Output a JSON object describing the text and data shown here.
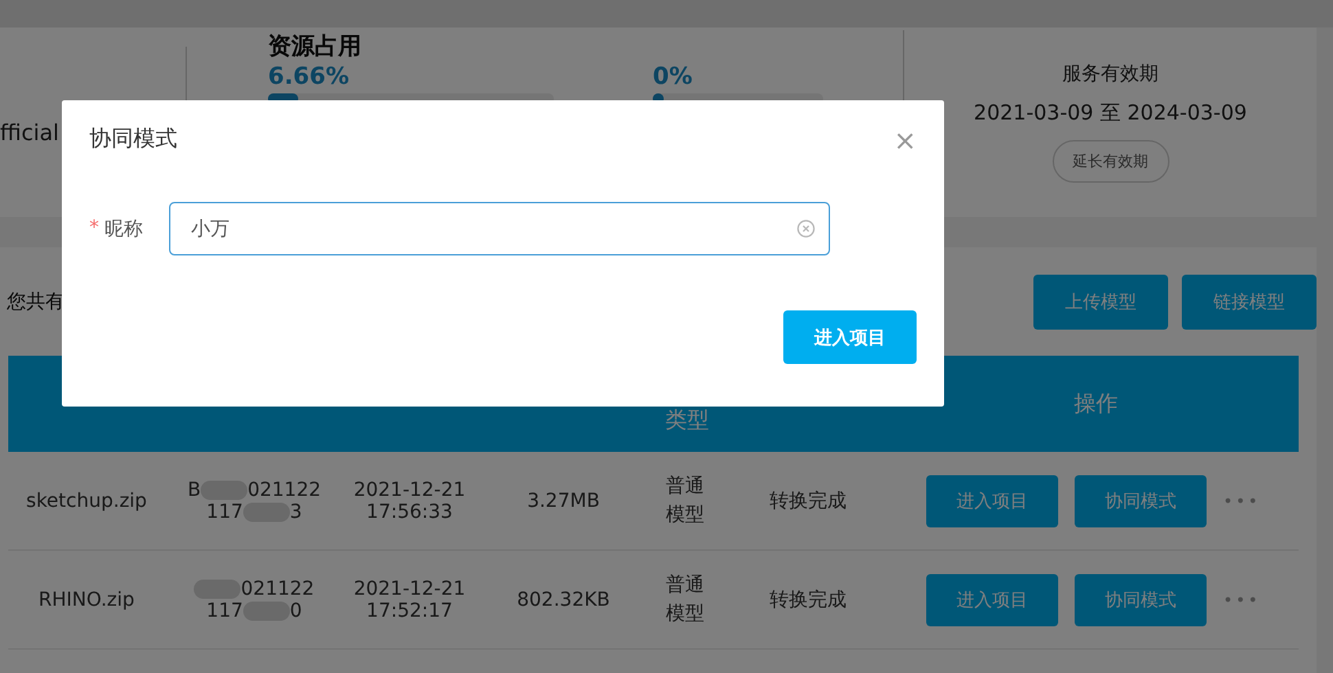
{
  "account": {
    "fragment": "fficial"
  },
  "resources": {
    "title": "资源占用",
    "meters": [
      {
        "reading": "6.66%",
        "level": 0.0666
      },
      {
        "reading": "0%",
        "level": 0
      }
    ]
  },
  "service": {
    "title": "服务有效期",
    "period": "2021-03-09 至 2024-03-09",
    "button": "延长有效期"
  },
  "summary": "您共有",
  "toolbar_buttons": [
    "上传模型",
    "链接模型"
  ],
  "table": {
    "type_header": "类型",
    "actions_header": "操作",
    "rows": [
      {
        "name": "sketchup.zip",
        "id_lines": [
          {
            "before": "B",
            "after": "021122"
          },
          {
            "before": "117",
            "after": "3"
          }
        ],
        "date": "2021-12-21",
        "time": "17:56:33",
        "size": "3.27MB",
        "type": "普通模型",
        "status": "转换完成",
        "actions": [
          "进入项目",
          "协同模式"
        ],
        "more": "•••"
      },
      {
        "name": "RHINO.zip",
        "id_lines": [
          {
            "after": "021122"
          },
          {
            "before": "117",
            "after": "0"
          }
        ],
        "date": "2021-12-21",
        "time": "17:52:17",
        "size": "802.32KB",
        "type": "普通模型",
        "status": "转换完成",
        "actions": [
          "进入项目",
          "协同模式"
        ],
        "more": "•••"
      }
    ]
  },
  "dialog": {
    "title": "协同模式",
    "close": "×",
    "field": {
      "label": "昵称",
      "required": true,
      "required_mark": "*",
      "value": "小万"
    },
    "button": "进入项目"
  }
}
